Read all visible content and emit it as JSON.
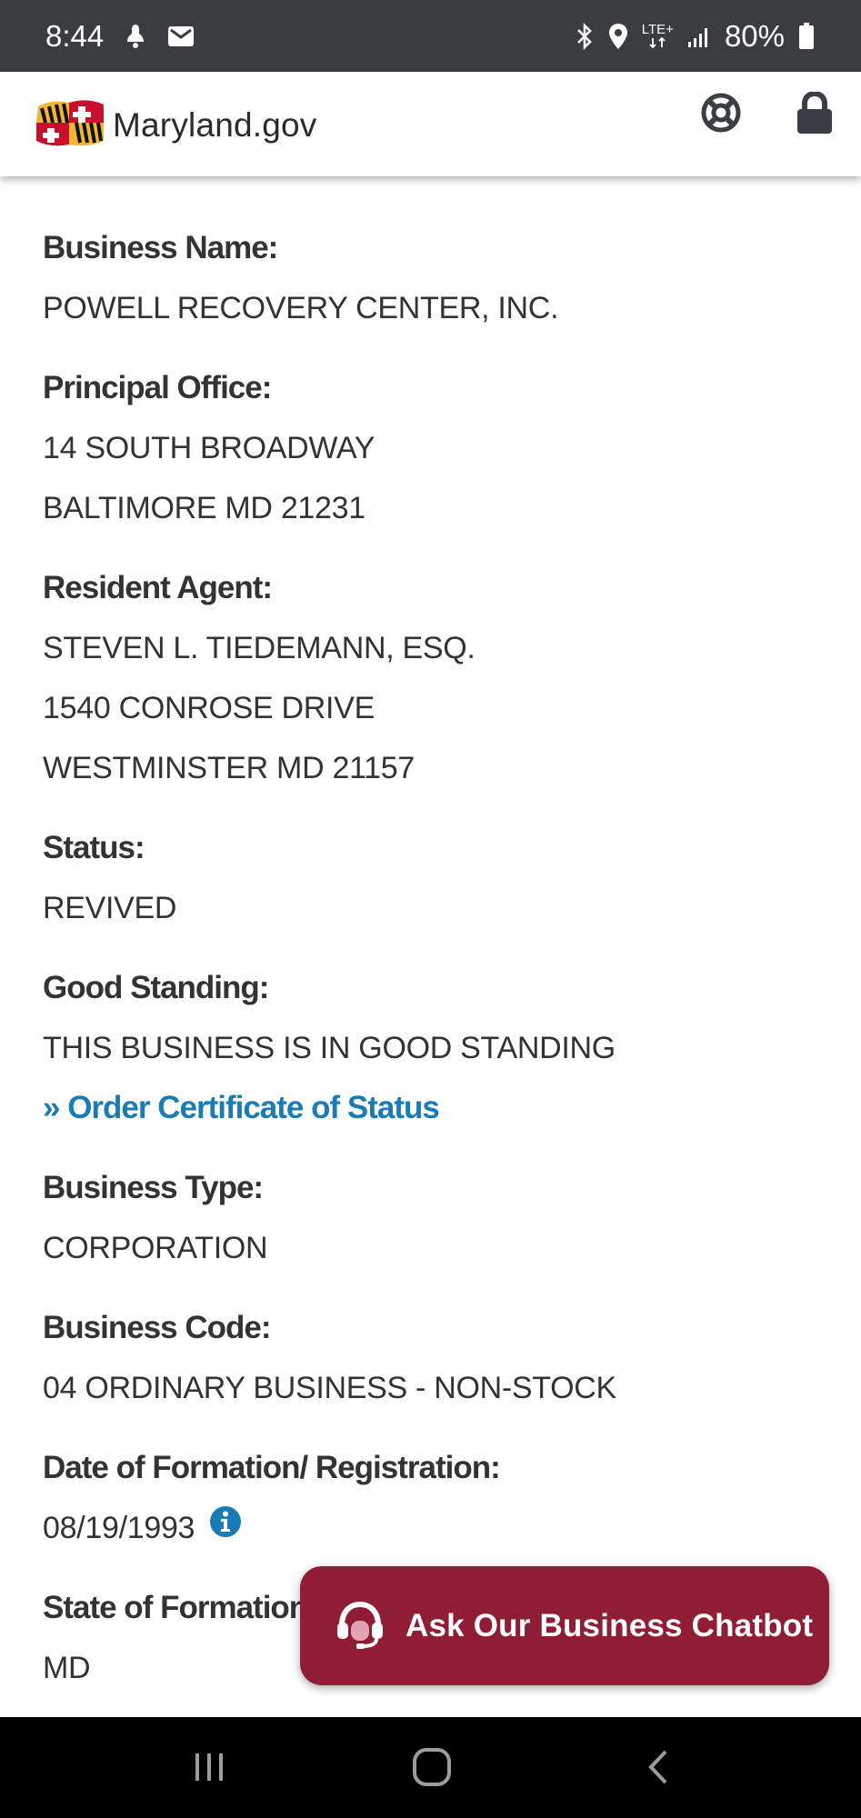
{
  "status_bar": {
    "time": "8:44",
    "network_label": "LTE+",
    "battery": "80%",
    "icons": [
      "notification-icon",
      "mail-icon",
      "bluetooth-icon",
      "location-icon",
      "network-icon",
      "signal-icon",
      "battery-icon"
    ]
  },
  "header": {
    "brand": "Maryland.gov",
    "icons": [
      "maryland-flag-icon",
      "help-icon",
      "lock-icon"
    ]
  },
  "fields": {
    "business_name": {
      "label": "Business Name:",
      "value": "POWELL RECOVERY CENTER, INC."
    },
    "principal_office": {
      "label": "Principal Office:",
      "lines": [
        "14 SOUTH BROADWAY",
        "BALTIMORE MD 21231"
      ]
    },
    "resident_agent": {
      "label": "Resident Agent:",
      "lines": [
        "STEVEN L. TIEDEMANN, ESQ.",
        "1540 CONROSE DRIVE",
        "WESTMINSTER MD 21157"
      ]
    },
    "status": {
      "label": "Status:",
      "value": "REVIVED"
    },
    "good_standing": {
      "label": "Good Standing:",
      "value": "THIS BUSINESS IS IN GOOD STANDING",
      "link": "» Order Certificate of Status"
    },
    "business_type": {
      "label": "Business Type:",
      "value": "CORPORATION"
    },
    "business_code": {
      "label": "Business Code:",
      "value": "04 ORDINARY BUSINESS - NON-STOCK"
    },
    "date_of_formation": {
      "label": "Date of Formation/ Registration:",
      "value": "08/19/1993"
    },
    "state_of_formation": {
      "label": "State of Formation",
      "value": "MD"
    }
  },
  "chatbot": {
    "label": "Ask Our Business Chatbot"
  },
  "colors": {
    "link": "#1a7cb7",
    "chat_button": "#8f1d35",
    "status_bar": "#3a3c40"
  }
}
